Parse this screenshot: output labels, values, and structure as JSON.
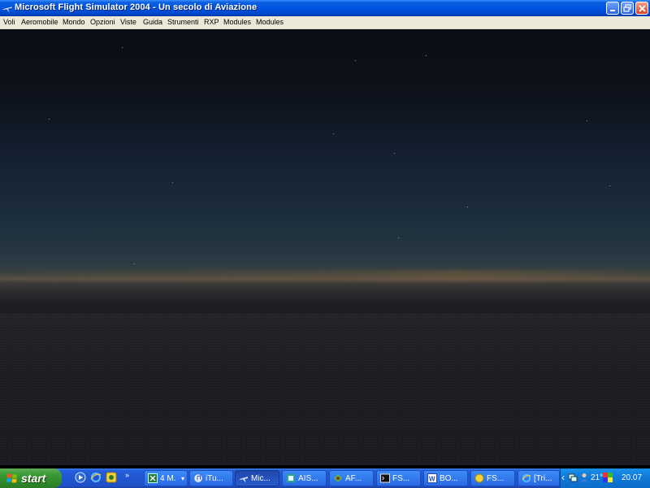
{
  "window": {
    "title": "Microsoft Flight Simulator 2004 - Un secolo di Aviazione",
    "app_icon": "plane-icon",
    "controls": [
      "minimize-icon",
      "restore-icon",
      "close-icon"
    ]
  },
  "menu": {
    "items": [
      "Voli",
      "Aeromobile",
      "Mondo",
      "Opzioni",
      "Viste",
      "Guida",
      "Strumenti",
      "RXP",
      "Modules",
      "Modules"
    ]
  },
  "scene": {
    "description_colors": {
      "sky_top": "#0a0d14",
      "horizon_glow": "#5a5145",
      "ground": "#1c1c22"
    }
  },
  "taskbar": {
    "start_label": "start",
    "quick_launch": [
      "media-icon",
      "ie-icon",
      "app-icon"
    ],
    "quick_launch_more": "»",
    "tasks": [
      {
        "label": "4 M.",
        "icon": "excel-icon",
        "dropdown": true
      },
      {
        "label": "iTu...",
        "icon": "itunes-icon"
      },
      {
        "label": "Mic...",
        "icon": "plane-icon",
        "active": true
      },
      {
        "label": "AIS...",
        "icon": "ais-icon"
      },
      {
        "label": "AF...",
        "icon": "af-icon"
      },
      {
        "label": "FS...",
        "icon": "console-icon"
      },
      {
        "label": "BO...",
        "icon": "word-icon"
      },
      {
        "label": "FS...",
        "icon": "fs-icon"
      },
      {
        "label": "[Tri...",
        "icon": "ie-icon"
      }
    ],
    "tray": {
      "temperature": "21°",
      "clock": "20.07"
    }
  }
}
